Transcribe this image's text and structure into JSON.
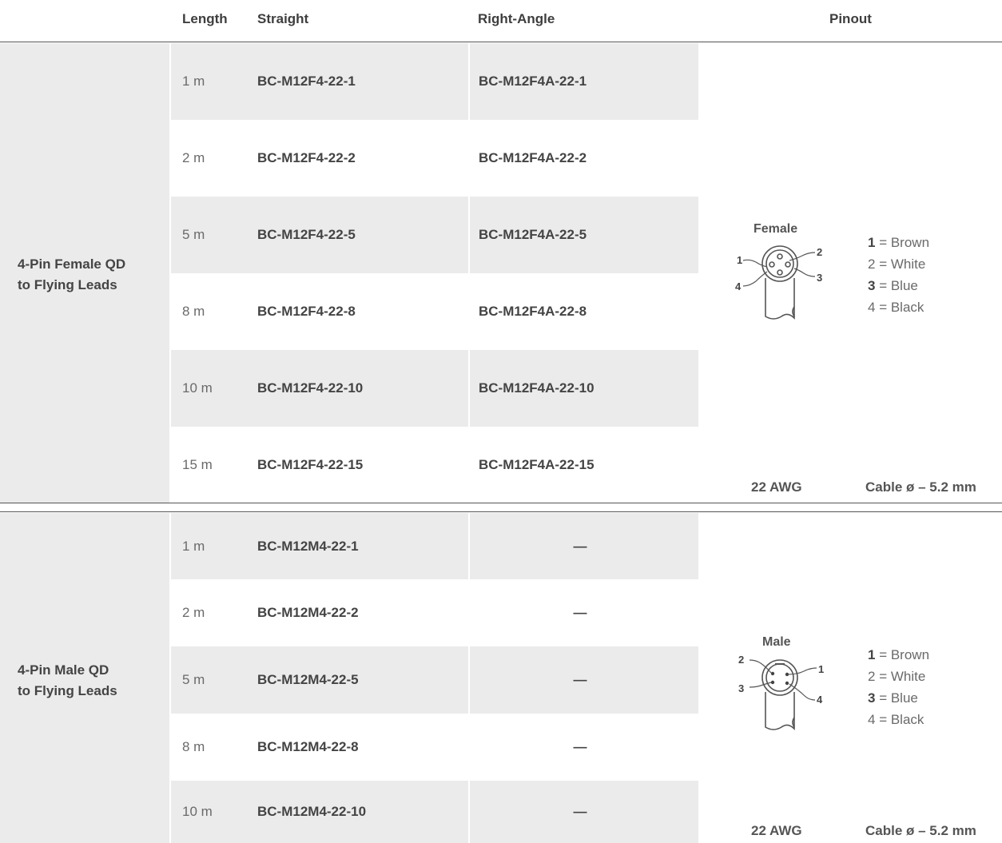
{
  "header": {
    "length": "Length",
    "straight": "Straight",
    "right_angle": "Right-Angle",
    "pinout": "Pinout"
  },
  "groups": [
    {
      "label_line1": "4-Pin Female QD",
      "label_line2": "to Flying Leads",
      "rows": [
        {
          "length": "1 m",
          "straight": "BC-M12F4-22-1",
          "right_angle": "BC-M12F4A-22-1"
        },
        {
          "length": "2 m",
          "straight": "BC-M12F4-22-2",
          "right_angle": "BC-M12F4A-22-2"
        },
        {
          "length": "5 m",
          "straight": "BC-M12F4-22-5",
          "right_angle": "BC-M12F4A-22-5"
        },
        {
          "length": "8 m",
          "straight": "BC-M12F4-22-8",
          "right_angle": "BC-M12F4A-22-8"
        },
        {
          "length": "10 m",
          "straight": "BC-M12F4-22-10",
          "right_angle": "BC-M12F4A-22-10"
        },
        {
          "length": "15 m",
          "straight": "BC-M12F4-22-15",
          "right_angle": "BC-M12F4A-22-15"
        }
      ],
      "pinout": {
        "title": "Female",
        "pin_labels": [
          "1",
          "2",
          "3",
          "4"
        ],
        "legend": [
          {
            "num": "1",
            "color": "Brown",
            "bold": true
          },
          {
            "num": "2",
            "color": "White",
            "bold": false
          },
          {
            "num": "3",
            "color": "Blue",
            "bold": true
          },
          {
            "num": "4",
            "color": "Black",
            "bold": false
          }
        ],
        "awg": "22 AWG",
        "cable": "Cable ø – 5.2 mm"
      }
    },
    {
      "label_line1": "4-Pin Male QD",
      "label_line2": "to Flying Leads",
      "rows": [
        {
          "length": "1 m",
          "straight": "BC-M12M4-22-1",
          "right_angle": "—"
        },
        {
          "length": "2 m",
          "straight": "BC-M12M4-22-2",
          "right_angle": "—"
        },
        {
          "length": "5 m",
          "straight": "BC-M12M4-22-5",
          "right_angle": "—"
        },
        {
          "length": "8 m",
          "straight": "BC-M12M4-22-8",
          "right_angle": "—"
        },
        {
          "length": "10 m",
          "straight": "BC-M12M4-22-10",
          "right_angle": "—"
        }
      ],
      "pinout": {
        "title": "Male",
        "pin_labels": [
          "2",
          "1",
          "3",
          "4"
        ],
        "legend": [
          {
            "num": "1",
            "color": "Brown",
            "bold": true
          },
          {
            "num": "2",
            "color": "White",
            "bold": false
          },
          {
            "num": "3",
            "color": "Blue",
            "bold": true
          },
          {
            "num": "4",
            "color": "Black",
            "bold": false
          }
        ],
        "awg": "22 AWG",
        "cable": "Cable ø – 5.2 mm"
      }
    }
  ],
  "colors": {
    "shade": "#ebebeb",
    "text": "#444444",
    "muted": "#6a6a6a",
    "rule": "#555555"
  }
}
